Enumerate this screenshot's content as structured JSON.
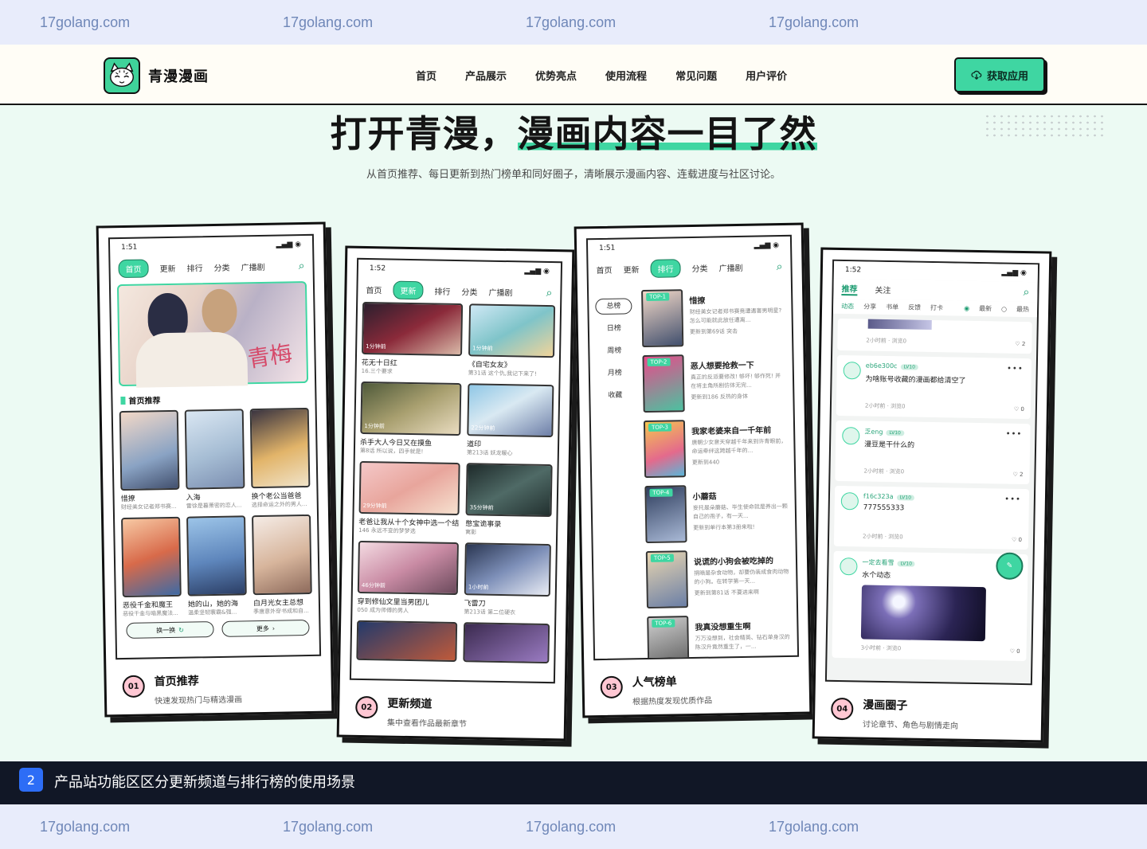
{
  "watermark": {
    "text": "17golang.com"
  },
  "nav": {
    "brand": "青漫漫画",
    "menu": [
      "首页",
      "产品展示",
      "优势亮点",
      "使用流程",
      "常见问题",
      "用户评价"
    ],
    "cta": "获取应用"
  },
  "hero": {
    "title_a": "打开青漫，",
    "title_b": "漫画内容一目了然",
    "subtitle": "从首页推荐、每日更新到热门榜单和同好圈子，清晰展示漫画内容、连载进度与社区讨论。"
  },
  "cards": [
    {
      "num": "01",
      "title": "首页推荐",
      "desc": "快速发现热门与精选漫画"
    },
    {
      "num": "02",
      "title": "更新频道",
      "desc": "集中查看作品最新章节"
    },
    {
      "num": "03",
      "title": "人气榜单",
      "desc": "根据热度发现优质作品"
    },
    {
      "num": "04",
      "title": "漫画圈子",
      "desc": "讨论章节、角色与剧情走向"
    }
  ],
  "phone1": {
    "time": "1:51",
    "tabs": [
      "首页",
      "更新",
      "排行",
      "分类",
      "广播剧"
    ],
    "section": "首页推荐",
    "items": [
      {
        "title": "惜撩",
        "sub": "财经美女记者郑书赛..."
      },
      {
        "title": "入海",
        "sub": "雷徐是暮萧密的恋人..."
      },
      {
        "title": "换个老公当爸爸",
        "sub": "选择命运之外的男人..."
      },
      {
        "title": "恶役千金和魔王",
        "sub": "恶役千金与暗黑魔法..."
      },
      {
        "title": "她的山，她的海",
        "sub": "温柔坚韧寰霸&强..."
      },
      {
        "title": "白月光女主总想",
        "sub": "季唐意外穿书成和自..."
      }
    ],
    "btn_swap": "换一换",
    "btn_more": "更多"
  },
  "phone2": {
    "time": "1:52",
    "tabs": [
      "首页",
      "更新",
      "排行",
      "分类",
      "广播剧"
    ],
    "items": [
      {
        "badge": "1分钟前",
        "title": "花无十日红",
        "sub": "16.三个要求"
      },
      {
        "badge": "1分钟前",
        "title": "《自宅女友》",
        "sub": "第31话 这个仇,我记下来了!"
      },
      {
        "badge": "1分钟前",
        "title": "杀手大人今日又在摸鱼",
        "sub": "第8话 所以说，四手就是!"
      },
      {
        "badge": "22分钟前",
        "title": "道印",
        "sub": "第213话 妖龙暖心"
      },
      {
        "badge": "29分钟前",
        "title": "老爸让我从十个女神中选一个结",
        "sub": "146 永远不变的梦梦选"
      },
      {
        "badge": "35分钟前",
        "title": "憋宝诡事录",
        "sub": "寓影"
      },
      {
        "badge": "46分钟前",
        "title": "穿到修仙文里当男团儿",
        "sub": "050 成为师傅的男人"
      },
      {
        "badge": "1小时前",
        "title": "飞雷刀",
        "sub": "第213话 第二位硬衣"
      }
    ]
  },
  "phone3": {
    "time": "1:51",
    "tabs": [
      "首页",
      "更新",
      "排行",
      "分类",
      "广播剧"
    ],
    "side": [
      "总榜",
      "日榜",
      "周榜",
      "月榜",
      "收藏"
    ],
    "items": [
      {
        "top": "TOP-1",
        "title": "惜撩",
        "desc": "财经美女记者郑书赛竟遭遇害男明星? 怎么可能就此放任遭离...",
        "upd": "更新到第69话 突击"
      },
      {
        "top": "TOP-2",
        "title": "恶人想要抢救一下",
        "desc": "真正的反派要修改! 够坏! 够作死! 并在将主角所剧仿体无完...",
        "upd": "更新到186 反热的身体"
      },
      {
        "top": "TOP-3",
        "title": "我家老婆来自一千年前",
        "desc": "唐朝少女意天穿越千年来到许青眼前，命运牵绊这跨越千年的...",
        "upd": "更新到440"
      },
      {
        "top": "TOP-4",
        "title": "小蘑菇",
        "desc": "妄托是朵蘑菇、毕生使命就是养出一颗自己的孢子，有一天...",
        "upd": "更新到单行本第3册来啦!"
      },
      {
        "top": "TOP-5",
        "title": "说谎的小狗会被吃掉的",
        "desc": "捐暗是杂食动物，却要伪装成食肉动物的小狗。在转学第一天...",
        "upd": "更新到第81话 不要进来啊"
      },
      {
        "top": "TOP-6",
        "title": "我真没想重生啊",
        "desc": "万万没想到，社会精英、钻石单身汉的陈汉升竟然重生了，一...",
        "upd": ""
      }
    ]
  },
  "phone4": {
    "time": "1:52",
    "tabs": [
      "推荐",
      "关注"
    ],
    "filters": [
      "动态",
      "分享",
      "书单",
      "反馈",
      "打卡"
    ],
    "sort": [
      "最新",
      "最热"
    ],
    "first_meta": "2小时前 · 浏览0",
    "first_likes": "2",
    "posts": [
      {
        "user": "eb6e300c",
        "lv": "LV10",
        "text": "为啥账号收藏的漫画都给清空了",
        "meta": "2小时前 · 浏览0",
        "likes": "0"
      },
      {
        "user": "乏eng",
        "lv": "LV10",
        "text": "漫豆是干什么的",
        "meta": "2小时前 · 浏览0",
        "likes": "2"
      },
      {
        "user": "f16c323a",
        "lv": "LV10",
        "text": "777555333",
        "meta": "2小时前 · 浏览0",
        "likes": "0"
      },
      {
        "user": "一定去看雪",
        "lv": "LV10",
        "text": "水个动态",
        "meta": "3小时前 · 浏览0",
        "likes": "0"
      }
    ]
  },
  "banner": {
    "num": "2",
    "text": "产品站功能区区分更新频道与排行榜的使用场景"
  },
  "colors": {
    "accent": "#3fd6a2",
    "ink": "#111111",
    "banner": "#111726",
    "badge": "#ffc7d3"
  }
}
